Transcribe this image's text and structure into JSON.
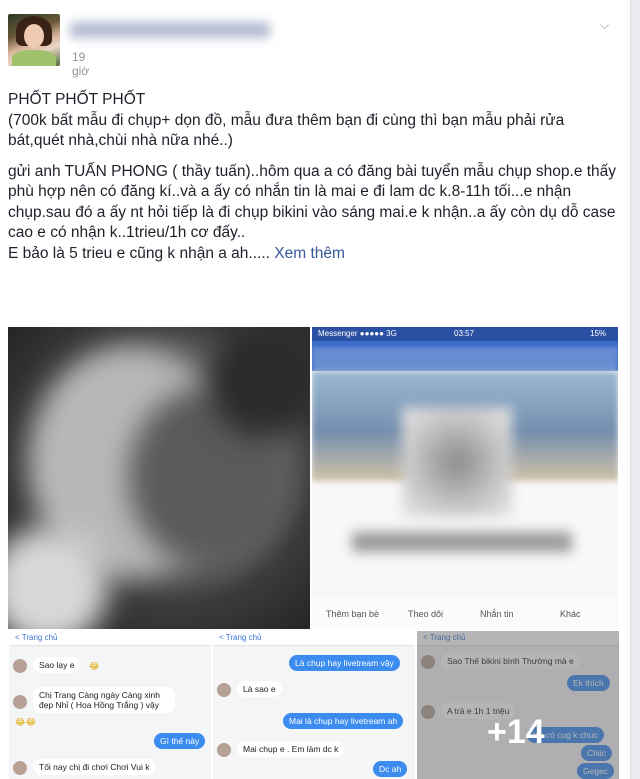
{
  "post": {
    "time": "19 giờ",
    "text": {
      "title": "PHỐT PHỐT PHỐT",
      "paren": "(700k bất mẫu đi chụp+ dọn đồ, mẫu đưa thêm bạn đi cùng thì bạn mẫu phải rửa bát,quét nhà,chùi nhà nữa nhé..)",
      "para": "gửi anh TUẤN PHONG ( thầy tuấn)..hôm qua a có đăng bài tuyển mẫu chụp shop.e thấy phù hợp nên có đăng kí..và a ấy có nhắn tin là mai e đi lam dc k.8-11h tối...e nhận chụp.sau đó a ấy nt hỏi tiếp là đi chụp bikini vào sáng mai.e k nhận..a ấy còn dụ dỗ case cao e có nhận k..1trieu/1h cơ đấy..",
      "last": "E bảo là 5 trieu e cũng k nhận a ah.....",
      "see_more": "Xem thêm"
    }
  },
  "phone": {
    "carrier": "Messenger ●●●●● 3G",
    "clock": "03:57",
    "battery": "15%",
    "actions": [
      "Thêm bạn bè",
      "Theo dõi",
      "Nhắn tin",
      "Khác"
    ]
  },
  "shots": [
    {
      "back": "< Trang chủ",
      "msgs": [
        {
          "side": "left",
          "text": "Sao lạy e"
        },
        {
          "side": "left",
          "text": "Chị Trang Càng ngày Càng xinh đẹp Nhỉ ( Hoa Hồng Trắng ) vậy"
        },
        {
          "side": "right",
          "text": "Gì thế này"
        },
        {
          "side": "left",
          "text": "Tối nay chị đi chơi Chơi Vui k"
        }
      ]
    },
    {
      "back": "< Trang chủ",
      "msgs": [
        {
          "side": "right",
          "text": "Là chụp hay livetream vậy"
        },
        {
          "side": "left",
          "text": "Là sao e"
        },
        {
          "side": "right",
          "text": "Mai là chụp hay livetream ah"
        },
        {
          "side": "left",
          "text": "Mai chụp e . Em làm dc k"
        },
        {
          "side": "right",
          "text": "Dc ah"
        }
      ]
    },
    {
      "back": "< Trang chủ",
      "msgs": [
        {
          "side": "left",
          "text": "Sao Thế bikini bình Thường mà e"
        },
        {
          "side": "right",
          "text": "Ek thích"
        },
        {
          "side": "left",
          "text": "A trả e 1h 1 triệu"
        },
        {
          "side": "right",
          "text": "Ko có cug k chuc"
        },
        {
          "side": "right",
          "text": "Chiịc"
        },
        {
          "side": "right",
          "text": "Gegec"
        }
      ],
      "overlay": "+14"
    }
  ]
}
